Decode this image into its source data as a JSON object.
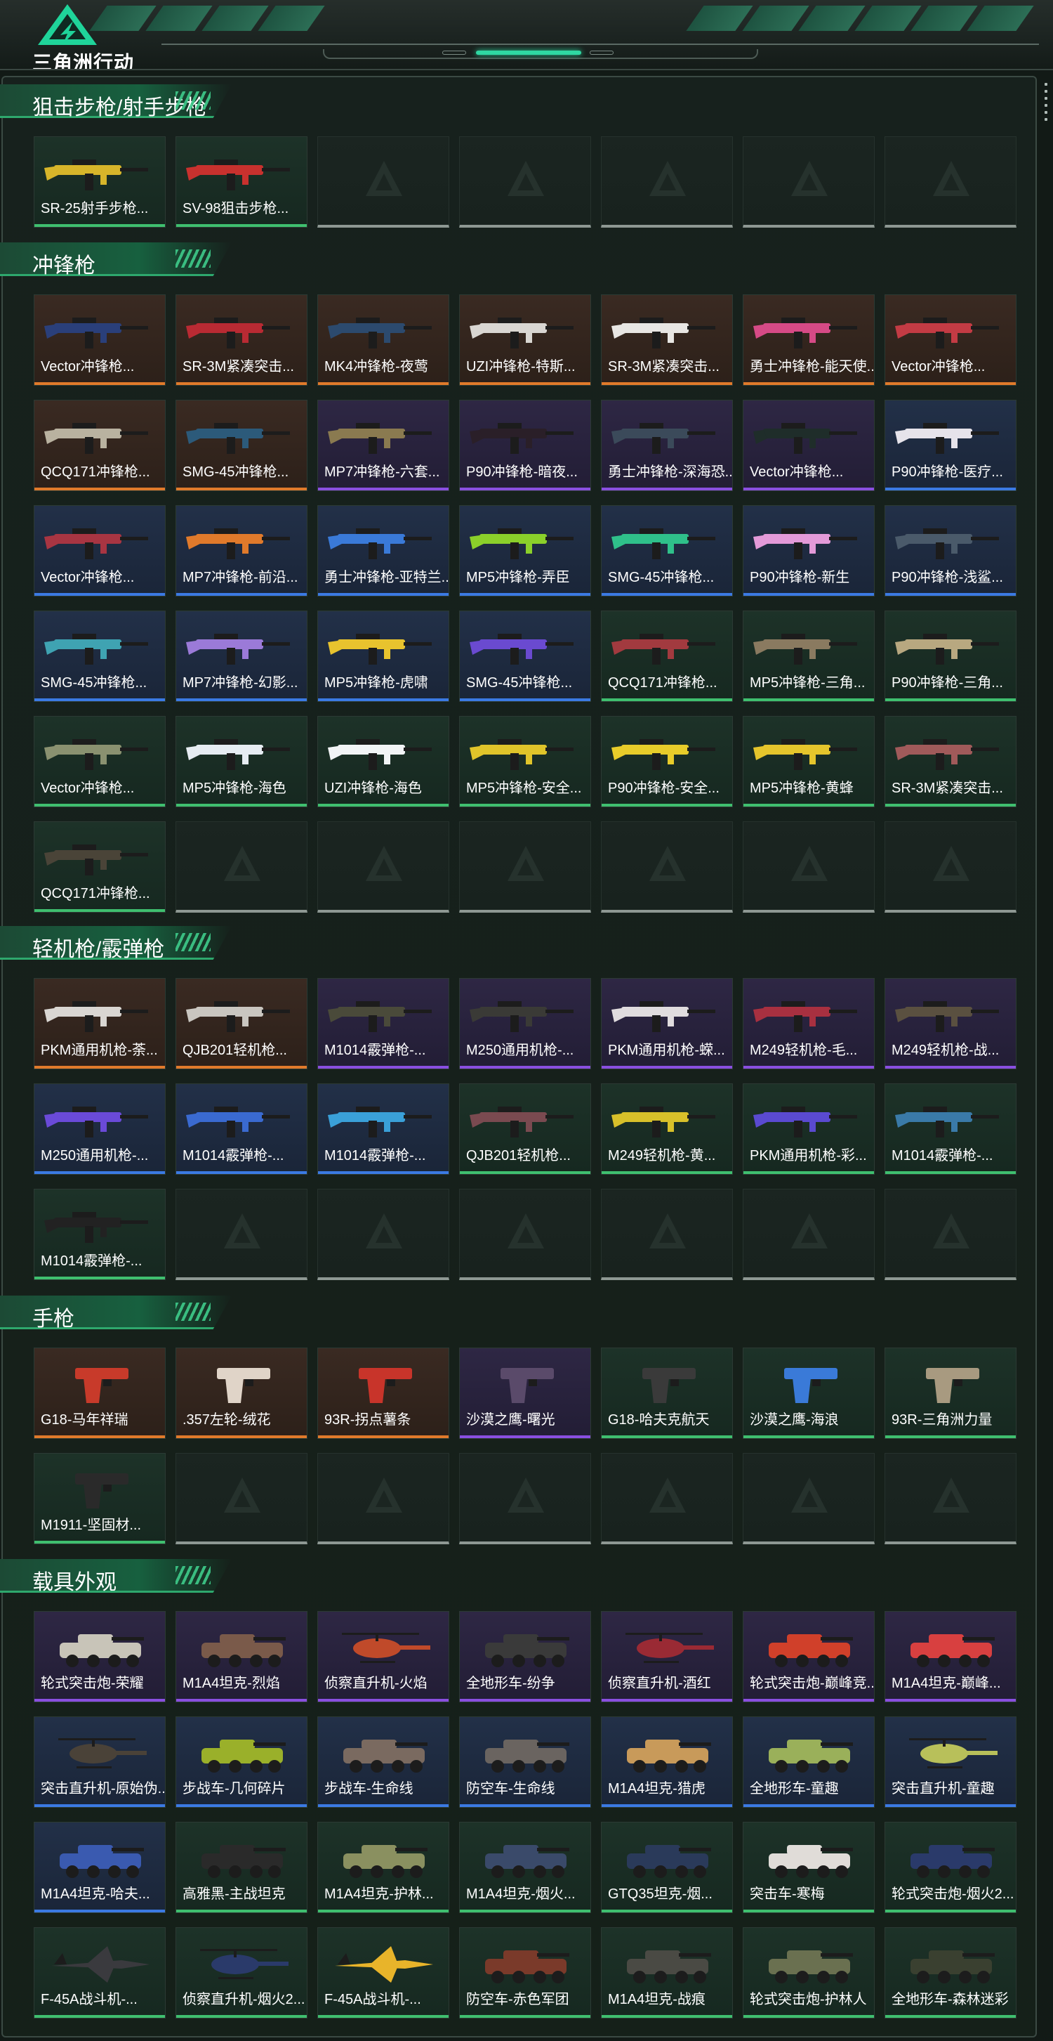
{
  "app": {
    "title": "三角洲行动"
  },
  "sections": [
    {
      "title": "狙击步枪/射手步枪",
      "slots": 7,
      "items": [
        {
          "name": "SR-25射手步枪...",
          "quality": "green",
          "icon": "rifle-icon",
          "color": "#d7b52a"
        },
        {
          "name": "SV-98狙击步枪...",
          "quality": "green",
          "icon": "sniper-rifle-icon",
          "color": "#c8312e"
        }
      ]
    },
    {
      "title": "冲锋枪",
      "slots": 42,
      "items": [
        {
          "name": "Vector冲锋枪...",
          "quality": "orange",
          "icon": "smg-icon",
          "color": "#2a3f7a"
        },
        {
          "name": "SR-3M紧凑突击...",
          "quality": "orange",
          "icon": "smg-icon",
          "color": "#b92a33"
        },
        {
          "name": "MK4冲锋枪-夜莺",
          "quality": "orange",
          "icon": "smg-icon",
          "color": "#2c4a6e"
        },
        {
          "name": "UZI冲锋枪-特斯...",
          "quality": "orange",
          "icon": "smg-icon",
          "color": "#d9d6d2"
        },
        {
          "name": "SR-3M紧凑突击...",
          "quality": "orange",
          "icon": "smg-icon",
          "color": "#e8e6e3"
        },
        {
          "name": "勇士冲锋枪-能天使...",
          "quality": "orange",
          "icon": "smg-icon",
          "color": "#d64a86"
        },
        {
          "name": "Vector冲锋枪...",
          "quality": "orange",
          "icon": "smg-icon",
          "color": "#c33b44"
        },
        {
          "name": "QCQ171冲锋枪...",
          "quality": "orange",
          "icon": "smg-icon",
          "color": "#b9b2a0"
        },
        {
          "name": "SMG-45冲锋枪...",
          "quality": "orange",
          "icon": "smg-icon",
          "color": "#2c5a7a"
        },
        {
          "name": "MP7冲锋枪-六套...",
          "quality": "purple",
          "icon": "smg-icon",
          "color": "#8a7a50"
        },
        {
          "name": "P90冲锋枪-暗夜...",
          "quality": "purple",
          "icon": "smg-icon",
          "color": "#2a1f28"
        },
        {
          "name": "勇士冲锋枪-深海恐...",
          "quality": "purple",
          "icon": "smg-icon",
          "color": "#3b4a5a"
        },
        {
          "name": "Vector冲锋枪...",
          "quality": "purple",
          "icon": "smg-icon",
          "color": "#1f2d2a"
        },
        {
          "name": "P90冲锋枪-医疗...",
          "quality": "blue",
          "icon": "smg-icon",
          "color": "#e6e3ea"
        },
        {
          "name": "Vector冲锋枪...",
          "quality": "blue",
          "icon": "smg-icon",
          "color": "#a83542"
        },
        {
          "name": "MP7冲锋枪-前沿...",
          "quality": "blue",
          "icon": "smg-icon",
          "color": "#e07a2b"
        },
        {
          "name": "勇士冲锋枪-亚特兰...",
          "quality": "blue",
          "icon": "smg-icon",
          "color": "#3a7ad8"
        },
        {
          "name": "MP5冲锋枪-弄臣",
          "quality": "blue",
          "icon": "smg-icon",
          "color": "#8bd02a"
        },
        {
          "name": "SMG-45冲锋枪...",
          "quality": "blue",
          "icon": "smg-icon",
          "color": "#2fc08a"
        },
        {
          "name": "P90冲锋枪-新生",
          "quality": "blue",
          "icon": "smg-icon",
          "color": "#e39ad8"
        },
        {
          "name": "P90冲锋枪-浅鲨...",
          "quality": "blue",
          "icon": "smg-icon",
          "color": "#4a5a6a"
        },
        {
          "name": "SMG-45冲锋枪...",
          "quality": "blue",
          "icon": "smg-icon",
          "color": "#3fa3b2"
        },
        {
          "name": "MP7冲锋枪-幻影...",
          "quality": "blue",
          "icon": "smg-icon",
          "color": "#9b7ad8"
        },
        {
          "name": "MP5冲锋枪-虎啸",
          "quality": "blue",
          "icon": "smg-icon",
          "color": "#e8c32e"
        },
        {
          "name": "SMG-45冲锋枪...",
          "quality": "blue",
          "icon": "smg-icon",
          "color": "#6a4ad0"
        },
        {
          "name": "QCQ171冲锋枪...",
          "quality": "green",
          "icon": "smg-icon",
          "color": "#a23a3f"
        },
        {
          "name": "MP5冲锋枪-三角...",
          "quality": "green",
          "icon": "smg-icon",
          "color": "#8a7a60"
        },
        {
          "name": "P90冲锋枪-三角...",
          "quality": "green",
          "icon": "smg-icon",
          "color": "#b8a880"
        },
        {
          "name": "Vector冲锋枪...",
          "quality": "green",
          "icon": "smg-icon",
          "color": "#8a9170"
        },
        {
          "name": "MP5冲锋枪-海色",
          "quality": "green",
          "icon": "smg-icon",
          "color": "#e6ecf2"
        },
        {
          "name": "UZI冲锋枪-海色",
          "quality": "green",
          "icon": "smg-icon",
          "color": "#f2f4f6"
        },
        {
          "name": "MP5冲锋枪-安全...",
          "quality": "green",
          "icon": "smg-icon",
          "color": "#e0c42a"
        },
        {
          "name": "P90冲锋枪-安全...",
          "quality": "green",
          "icon": "smg-icon",
          "color": "#e8cc2a"
        },
        {
          "name": "MP5冲锋枪-黄蜂",
          "quality": "green",
          "icon": "smg-icon",
          "color": "#e5c52c"
        },
        {
          "name": "SR-3M紧凑突击...",
          "quality": "green",
          "icon": "smg-icon",
          "color": "#a05a5a"
        },
        {
          "name": "QCQ171冲锋枪...",
          "quality": "green",
          "icon": "smg-icon",
          "color": "#4a4438"
        }
      ]
    },
    {
      "title": "轻机枪/霰弹枪",
      "slots": 21,
      "items": [
        {
          "name": "PKM通用机枪-荼...",
          "quality": "orange",
          "icon": "machine-gun-icon",
          "color": "#d9d6d2"
        },
        {
          "name": "QJB201轻机枪...",
          "quality": "orange",
          "icon": "machine-gun-icon",
          "color": "#c9c6c0"
        },
        {
          "name": "M1014霰弹枪-...",
          "quality": "purple",
          "icon": "shotgun-icon",
          "color": "#4a4a3a"
        },
        {
          "name": "M250通用机枪-...",
          "quality": "purple",
          "icon": "machine-gun-icon",
          "color": "#3a3a36"
        },
        {
          "name": "PKM通用机枪-蝾...",
          "quality": "purple",
          "icon": "machine-gun-icon",
          "color": "#e0dcde"
        },
        {
          "name": "M249轻机枪-毛...",
          "quality": "purple",
          "icon": "machine-gun-icon",
          "color": "#a83040"
        },
        {
          "name": "M249轻机枪-战...",
          "quality": "purple",
          "icon": "machine-gun-icon",
          "color": "#5a5040"
        },
        {
          "name": "M250通用机枪-...",
          "quality": "blue",
          "icon": "machine-gun-icon",
          "color": "#6a4ad8"
        },
        {
          "name": "M1014霰弹枪-...",
          "quality": "blue",
          "icon": "shotgun-icon",
          "color": "#3a6ad0"
        },
        {
          "name": "M1014霰弹枪-...",
          "quality": "blue",
          "icon": "shotgun-icon",
          "color": "#3aa0d8"
        },
        {
          "name": "QJB201轻机枪...",
          "quality": "green",
          "icon": "machine-gun-icon",
          "color": "#7a4a50"
        },
        {
          "name": "M249轻机枪-黄...",
          "quality": "green",
          "icon": "machine-gun-icon",
          "color": "#d8c02a"
        },
        {
          "name": "PKM通用机枪-彩...",
          "quality": "green",
          "icon": "machine-gun-icon",
          "color": "#5a4ad0"
        },
        {
          "name": "M1014霰弹枪-...",
          "quality": "green",
          "icon": "shotgun-icon",
          "color": "#3a7aa8"
        },
        {
          "name": "M1014霰弹枪-...",
          "quality": "green",
          "icon": "shotgun-icon",
          "color": "#222222"
        }
      ]
    },
    {
      "title": "手枪",
      "slots": 14,
      "items": [
        {
          "name": "G18-马年祥瑞",
          "quality": "orange",
          "icon": "pistol-icon",
          "color": "#c83a2a"
        },
        {
          "name": ".357左轮-绒花",
          "quality": "orange",
          "icon": "revolver-icon",
          "color": "#e0d4c8"
        },
        {
          "name": "93R-拐点薯条",
          "quality": "orange",
          "icon": "pistol-icon",
          "color": "#c8342a"
        },
        {
          "name": "沙漠之鹰-曙光",
          "quality": "purple",
          "icon": "pistol-icon",
          "color": "#5a4a6a"
        },
        {
          "name": "G18-哈夫克航天",
          "quality": "green",
          "icon": "pistol-icon",
          "color": "#3a3a3a"
        },
        {
          "name": "沙漠之鹰-海浪",
          "quality": "green",
          "icon": "pistol-icon",
          "color": "#3a7ad8"
        },
        {
          "name": "93R-三角洲力量",
          "quality": "green",
          "icon": "pistol-icon",
          "color": "#a89a80"
        },
        {
          "name": "M1911-坚固材...",
          "quality": "green",
          "icon": "pistol-icon",
          "color": "#2a2a2a"
        }
      ]
    },
    {
      "title": "载具外观",
      "slots": 28,
      "items": [
        {
          "name": "轮式突击炮-荣耀",
          "quality": "purple",
          "icon": "armored-car-icon",
          "color": "#c8c4b8"
        },
        {
          "name": "M1A4坦克-烈焰",
          "quality": "purple",
          "icon": "tank-icon",
          "color": "#7a5a4a"
        },
        {
          "name": "侦察直升机-火焰",
          "quality": "purple",
          "icon": "helicopter-icon",
          "color": "#c04a2a"
        },
        {
          "name": "全地形车-纷争",
          "quality": "purple",
          "icon": "atv-icon",
          "color": "#3a3a3a"
        },
        {
          "name": "侦察直升机-酒红",
          "quality": "purple",
          "icon": "helicopter-icon",
          "color": "#9a2a34"
        },
        {
          "name": "轮式突击炮-巅峰竞...",
          "quality": "purple",
          "icon": "armored-car-icon",
          "color": "#d0402a"
        },
        {
          "name": "M1A4坦克-巅峰...",
          "quality": "purple",
          "icon": "tank-icon",
          "color": "#d84040"
        },
        {
          "name": "突击直升机-原始伪...",
          "quality": "blue",
          "icon": "helicopter-icon",
          "color": "#4a4238"
        },
        {
          "name": "步战车-几何碎片",
          "quality": "blue",
          "icon": "ifv-icon",
          "color": "#9ab02a"
        },
        {
          "name": "步战车-生命线",
          "quality": "blue",
          "icon": "ifv-icon",
          "color": "#7a6a60"
        },
        {
          "name": "防空车-生命线",
          "quality": "blue",
          "icon": "aa-vehicle-icon",
          "color": "#6a6460"
        },
        {
          "name": "M1A4坦克-猎虎",
          "quality": "blue",
          "icon": "tank-icon",
          "color": "#c89a5a"
        },
        {
          "name": "全地形车-童趣",
          "quality": "blue",
          "icon": "atv-icon",
          "color": "#9ab05a"
        },
        {
          "name": "突击直升机-童趣",
          "quality": "blue",
          "icon": "helicopter-icon",
          "color": "#b8c05a"
        },
        {
          "name": "M1A4坦克-哈夫...",
          "quality": "blue",
          "icon": "tank-icon",
          "color": "#3a5ab0"
        },
        {
          "name": "高雅黑-主战坦克",
          "quality": "green",
          "icon": "tank-icon",
          "color": "#2a2a2a"
        },
        {
          "name": "M1A4坦克-护林...",
          "quality": "green",
          "icon": "tank-icon",
          "color": "#8a9060"
        },
        {
          "name": "M1A4坦克-烟火...",
          "quality": "green",
          "icon": "tank-icon",
          "color": "#3a4a6a"
        },
        {
          "name": "GTQ35坦克-烟...",
          "quality": "green",
          "icon": "tank-icon",
          "color": "#2a3a5a"
        },
        {
          "name": "突击车-寒梅",
          "quality": "green",
          "icon": "assault-vehicle-icon",
          "color": "#e0dcd8"
        },
        {
          "name": "轮式突击炮-烟火2...",
          "quality": "green",
          "icon": "armored-car-icon",
          "color": "#2a3a6a"
        },
        {
          "name": "F-45A战斗机-...",
          "quality": "green",
          "icon": "fighter-jet-icon",
          "color": "#3a3a3e"
        },
        {
          "name": "侦察直升机-烟火2...",
          "quality": "green",
          "icon": "helicopter-icon",
          "color": "#2a3a6a"
        },
        {
          "name": "F-45A战斗机-...",
          "quality": "green",
          "icon": "fighter-jet-icon",
          "color": "#e8b42a"
        },
        {
          "name": "防空车-赤色军团",
          "quality": "green",
          "icon": "aa-vehicle-icon",
          "color": "#7a3a2a"
        },
        {
          "name": "M1A4坦克-战痕",
          "quality": "green",
          "icon": "tank-icon",
          "color": "#4a4a44"
        },
        {
          "name": "轮式突击炮-护林人",
          "quality": "green",
          "icon": "armored-car-icon",
          "color": "#6a7050"
        },
        {
          "name": "全地形车-森林迷彩",
          "quality": "green",
          "icon": "atv-icon",
          "color": "#3a4030"
        }
      ]
    }
  ]
}
